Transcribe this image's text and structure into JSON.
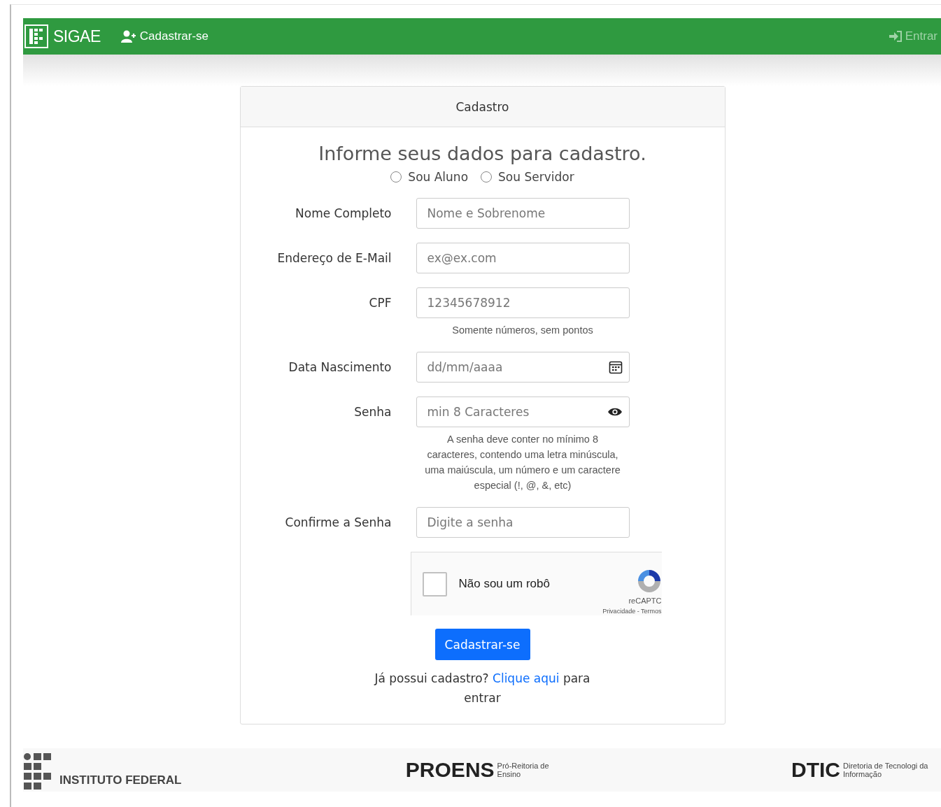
{
  "navbar": {
    "brand": "SIGAE",
    "links": [
      {
        "label": "Cadastrar-se",
        "selected": true
      }
    ],
    "login_link": "Entrar"
  },
  "card": {
    "header": "Cadastro",
    "title": "Informe seus dados para cadastro.",
    "radios": [
      {
        "label": "Sou Aluno",
        "selected": false
      },
      {
        "label": "Sou Servidor",
        "selected": false
      }
    ],
    "fields": [
      {
        "kind": "text",
        "label": "Nome Completo",
        "placeholder": "Nome e Sobrenome"
      },
      {
        "kind": "text",
        "label": "Endereço de E-Mail",
        "placeholder": "ex@ex.com"
      },
      {
        "kind": "text",
        "label": "CPF",
        "placeholder": "12345678912",
        "help": "Somente números, sem pontos"
      },
      {
        "kind": "date",
        "label": "Data Nascimento",
        "placeholder": "dd/mm/aaaa"
      },
      {
        "kind": "password",
        "label": "Senha",
        "placeholder": "min 8 Caracteres",
        "help": "A senha deve conter no mínimo 8 caracteres, contendo uma letra minúscula, uma maiúscula, um número e um caractere especial (!, @, &, etc)"
      },
      {
        "kind": "text",
        "label": "Confirme a Senha",
        "placeholder": "Digite a senha"
      }
    ],
    "captcha": {
      "label": "Não sou um robô",
      "checked": false,
      "brand": "reCAPTC",
      "links": "Privacidade - Termos"
    },
    "submit": "Cadastrar-se",
    "login_prompt": {
      "before": "Já possui cadastro?",
      "link": "Clique aqui",
      "after": "para entrar"
    }
  },
  "footer": {
    "logos": [
      {
        "name": "INSTITUTO FEDERAL"
      },
      {
        "name": "PROENS",
        "subtitle": "Pró-Reitoria de Ensino"
      },
      {
        "name": "DTIC",
        "subtitle": "Diretoria de Tecnologi da Informação"
      }
    ]
  }
}
